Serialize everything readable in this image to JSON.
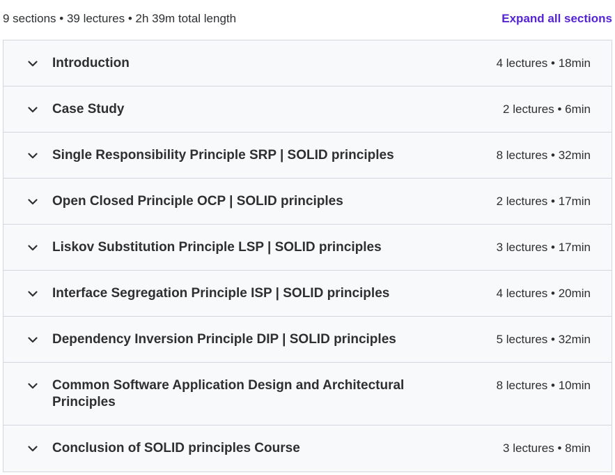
{
  "summary": {
    "text": "9 sections • 39 lectures • 2h 39m total length",
    "expand_label": "Expand all sections"
  },
  "colors": {
    "accent": "#5624d0",
    "section_bg": "#f7f9fa",
    "border": "#d1d7dc",
    "text": "#2d2f31"
  },
  "icons": {
    "toggle": "chevron-down-icon"
  },
  "sections": [
    {
      "title": "Introduction",
      "meta": "4 lectures • 18min"
    },
    {
      "title": "Case Study",
      "meta": "2 lectures • 6min"
    },
    {
      "title": "Single Responsibility Principle SRP | SOLID principles",
      "meta": "8 lectures • 32min"
    },
    {
      "title": "Open Closed Principle OCP | SOLID principles",
      "meta": "2 lectures • 17min"
    },
    {
      "title": "Liskov Substitution Principle LSP | SOLID principles",
      "meta": "3 lectures • 17min"
    },
    {
      "title": "Interface Segregation Principle ISP | SOLID principles",
      "meta": "4 lectures • 20min"
    },
    {
      "title": "Dependency Inversion Principle DIP | SOLID principles",
      "meta": "5 lectures • 32min"
    },
    {
      "title": "Common Software Application Design and Architectural Principles",
      "meta": "8 lectures • 10min"
    },
    {
      "title": "Conclusion of SOLID principles Course",
      "meta": "3 lectures • 8min"
    }
  ]
}
